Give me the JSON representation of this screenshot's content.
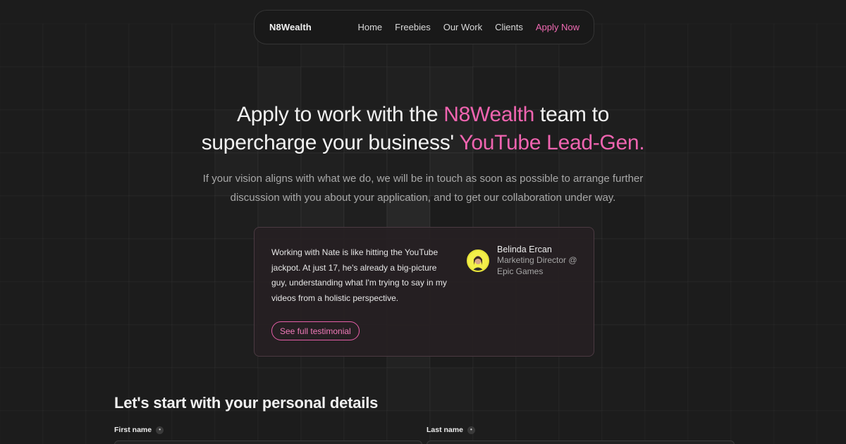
{
  "nav": {
    "brand": "N8Wealth",
    "links": [
      "Home",
      "Freebies",
      "Our Work",
      "Clients"
    ],
    "cta": "Apply Now"
  },
  "hero": {
    "line1_a": "Apply to work with the ",
    "line1_highlight": "N8Wealth",
    "line1_b": " team to",
    "line2_a": "supercharge your business' ",
    "line2_highlight": "YouTube Lead-Gen.",
    "subtitle": "If your vision aligns with what we do, we will be in touch as soon as possible to arrange further discussion with you about your application, and to get our collaboration under way."
  },
  "testimonial": {
    "quote": "Working with Nate is like hitting the YouTube jackpot. At just 17, he's already a big-picture guy, understanding what I'm trying to say in my videos from a holistic perspective.",
    "author_name": "Belinda Ercan",
    "author_role": "Marketing Director @ Epic Games",
    "button": "See full testimonial"
  },
  "form": {
    "section_title": "Let's start with your personal details",
    "first_name_label": "First name",
    "last_name_label": "Last name",
    "required_marker": "•"
  },
  "colors": {
    "accent": "#f064b0",
    "background": "#1c1c1c"
  }
}
